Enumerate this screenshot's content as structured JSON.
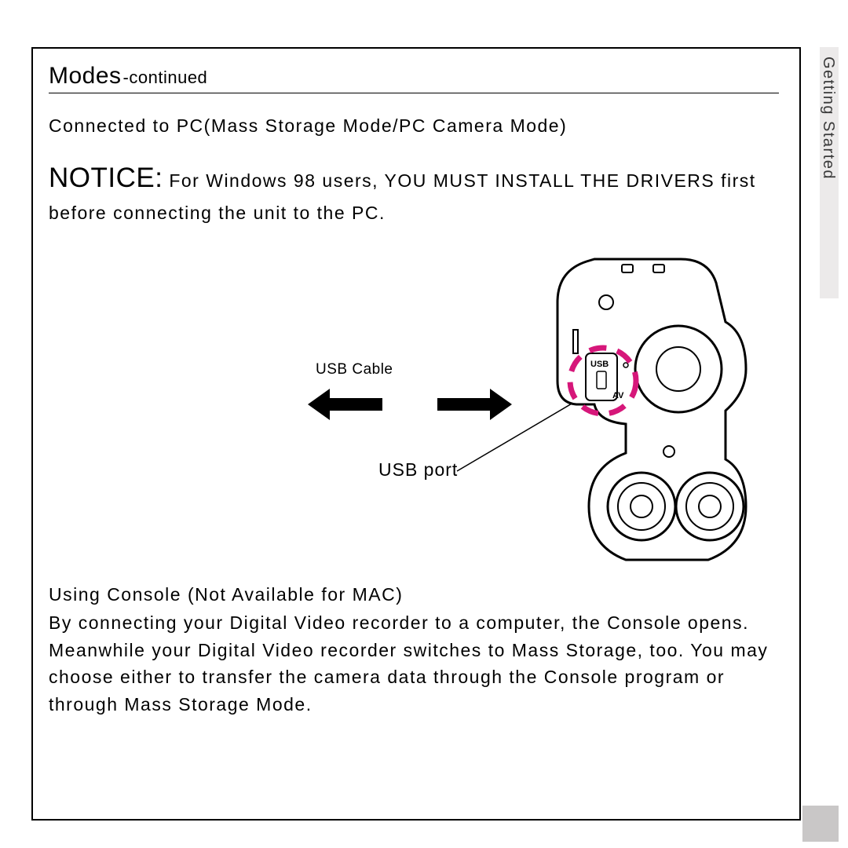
{
  "sideTab": "Getting Started",
  "heading": {
    "main": "Modes",
    "sub": "-continued"
  },
  "subhead": "Connected to PC(Mass Storage Mode/PC Camera Mode)",
  "notice": {
    "word": "NOTICE:",
    "rest": " For Windows 98 users, YOU MUST INSTALL THE DRIVERS first before connecting the unit to the PC."
  },
  "diagram": {
    "usbCable": "USB Cable",
    "usbPort": "USB port",
    "portLabels": {
      "usb": "USB",
      "av": "AV"
    }
  },
  "console": {
    "title": "Using Console (Not Available for MAC)",
    "body": "By connecting your Digital Video recorder to a computer, the Console opens. Meanwhile your Digital Video recorder switches to Mass Storage, too. You may choose either to transfer the camera data through the Console program or through Mass Storage Mode."
  }
}
